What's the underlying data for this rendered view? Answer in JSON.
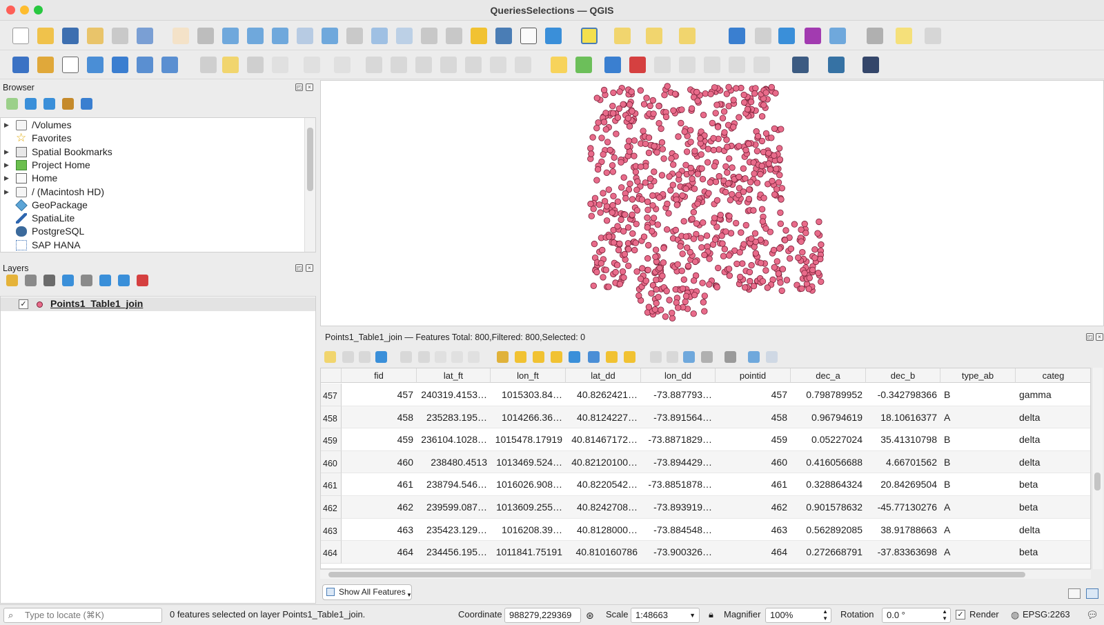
{
  "window": {
    "title": "QueriesSelections — QGIS"
  },
  "colors": {
    "point_fill": "#e86b8a",
    "point_stroke": "#7a2038",
    "accent_select": "#f4e04d"
  },
  "browser": {
    "title": "Browser",
    "items": [
      {
        "label": "/Volumes",
        "icon": "folder-icon",
        "expandable": true
      },
      {
        "label": "Favorites",
        "icon": "star-icon",
        "expandable": false
      },
      {
        "label": "Spatial Bookmarks",
        "icon": "bookmark-icon",
        "expandable": true
      },
      {
        "label": "Project Home",
        "icon": "project-home-icon",
        "expandable": true
      },
      {
        "label": "Home",
        "icon": "home-icon",
        "expandable": true
      },
      {
        "label": "/ (Macintosh HD)",
        "icon": "folder-icon",
        "expandable": true
      },
      {
        "label": "GeoPackage",
        "icon": "geopackage-icon",
        "expandable": false
      },
      {
        "label": "SpatiaLite",
        "icon": "spatialite-icon",
        "expandable": false
      },
      {
        "label": "PostgreSQL",
        "icon": "postgresql-icon",
        "expandable": false
      },
      {
        "label": "SAP HANA",
        "icon": "sap-hana-icon",
        "expandable": false
      }
    ]
  },
  "layers": {
    "title": "Layers",
    "items": [
      {
        "label": "Points1_Table1_join",
        "checked": true,
        "symbol_color": "#e86b8a"
      }
    ]
  },
  "attribute_table": {
    "title": "Points1_Table1_join — Features Total: 800,Filtered: 800,Selected: 0",
    "columns": [
      "fid",
      "lat_ft",
      "lon_ft",
      "lat_dd",
      "lon_dd",
      "pointid",
      "dec_a",
      "dec_b",
      "type_ab",
      "categ"
    ],
    "rows": [
      {
        "row": "457",
        "cells": [
          "457",
          "240319.4153…",
          "1015303.84…",
          "40.8262421…",
          "-73.887793…",
          "457",
          "0.798789952",
          "-0.342798366",
          "B",
          "gamma"
        ]
      },
      {
        "row": "458",
        "cells": [
          "458",
          "235283.195…",
          "1014266.36…",
          "40.8124227…",
          "-73.891564…",
          "458",
          "0.96794619",
          "18.10616377",
          "A",
          "delta"
        ]
      },
      {
        "row": "459",
        "cells": [
          "459",
          "236104.1028…",
          "1015478.17919",
          "40.81467172…",
          "-73.8871829…",
          "459",
          "0.05227024",
          "35.41310798",
          "B",
          "delta"
        ]
      },
      {
        "row": "460",
        "cells": [
          "460",
          "238480.4513",
          "1013469.524…",
          "40.82120100…",
          "-73.894429…",
          "460",
          "0.416056688",
          "4.66701562",
          "B",
          "delta"
        ]
      },
      {
        "row": "461",
        "cells": [
          "461",
          "238794.546…",
          "1016026.908…",
          "40.8220542…",
          "-73.8851878…",
          "461",
          "0.328864324",
          "20.84269504",
          "B",
          "beta"
        ]
      },
      {
        "row": "462",
        "cells": [
          "462",
          "239599.087…",
          "1013609.255…",
          "40.8242708…",
          "-73.893919…",
          "462",
          "0.901578632",
          "-45.77130276",
          "A",
          "beta"
        ]
      },
      {
        "row": "463",
        "cells": [
          "463",
          "235423.129…",
          "1016208.39…",
          "40.8128000…",
          "-73.884548…",
          "463",
          "0.562892085",
          "38.91788663",
          "A",
          "delta"
        ]
      },
      {
        "row": "464",
        "cells": [
          "464",
          "234456.195…",
          "1011841.75191",
          "40.810160786",
          "-73.900326…",
          "464",
          "0.272668791",
          "-37.83363698",
          "A",
          "beta"
        ]
      }
    ],
    "show_all_label": "Show All Features"
  },
  "status": {
    "locate_placeholder": "Type to locate (⌘K)",
    "message": "0 features selected on layer Points1_Table1_join.",
    "coordinate_label": "Coordinate",
    "coordinate_value": "988279,229369",
    "scale_label": "Scale",
    "scale_value": "1:48663",
    "magnifier_label": "Magnifier",
    "magnifier_value": "100%",
    "rotation_label": "Rotation",
    "rotation_value": "0.0 °",
    "render_label": "Render",
    "render_checked": true,
    "crs": "EPSG:2263"
  }
}
